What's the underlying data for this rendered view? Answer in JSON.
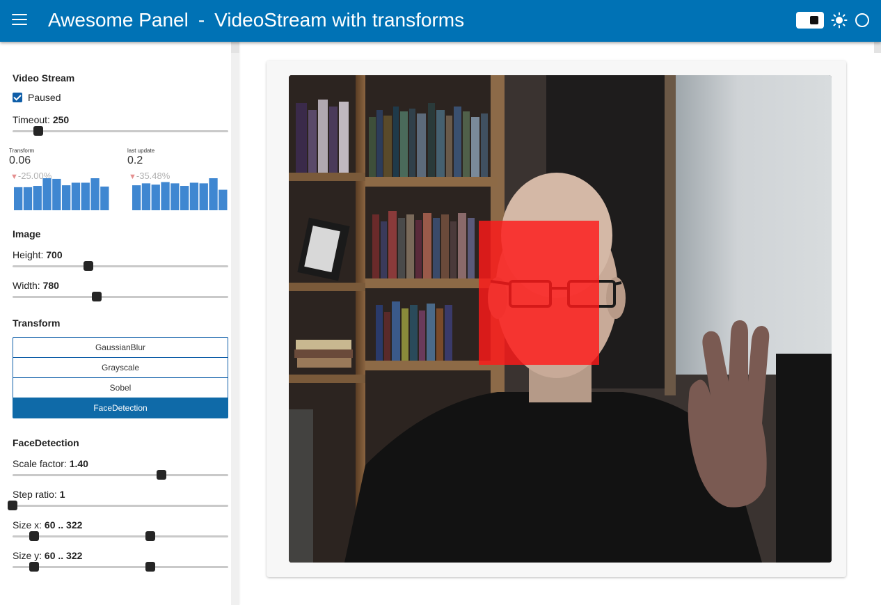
{
  "header": {
    "app_title": "Awesome Panel",
    "separator": "-",
    "page_title": "VideoStream with transforms",
    "accent_color": "#0072b5"
  },
  "sidebar": {
    "video_stream": {
      "title": "Video Stream",
      "paused_label": "Paused",
      "paused": true,
      "timeout_label": "Timeout: ",
      "timeout_value": "250",
      "timeout_fraction": 0.12
    },
    "indicators": [
      {
        "name": "Transform",
        "value": "0.06",
        "change": "-25.00%",
        "bars": [
          0.72,
          0.72,
          0.76,
          1.0,
          0.98,
          0.78,
          0.86,
          0.86,
          1.0,
          0.74
        ]
      },
      {
        "name": "last update",
        "value": "0.2",
        "change": "-35.48%",
        "bars": [
          0.78,
          0.84,
          0.8,
          0.88,
          0.84,
          0.76,
          0.86,
          0.84,
          1.0,
          0.64
        ]
      }
    ],
    "image": {
      "title": "Image",
      "height_label": "Height: ",
      "height_value": "700",
      "height_fraction": 0.35,
      "width_label": "Width: ",
      "width_value": "780",
      "width_fraction": 0.39
    },
    "transform": {
      "title": "Transform",
      "options": [
        "GaussianBlur",
        "Grayscale",
        "Sobel",
        "FaceDetection"
      ],
      "selected": "FaceDetection"
    },
    "face_detection": {
      "title": "FaceDetection",
      "scale_label": "Scale factor: ",
      "scale_value": "1.40",
      "scale_fraction": 0.69,
      "step_label": "Step ratio: ",
      "step_value": "1",
      "step_fraction": 0.0,
      "size_x_label": "Size x: ",
      "size_x_value": "60 .. 322",
      "size_x_range": [
        0.1,
        0.64
      ],
      "size_y_label": "Size y: ",
      "size_y_value": "60 .. 322",
      "size_y_range": [
        0.1,
        0.64
      ]
    }
  },
  "video": {
    "overlay_color": "#ff1a1a",
    "bar_color": "#3f87d1"
  }
}
